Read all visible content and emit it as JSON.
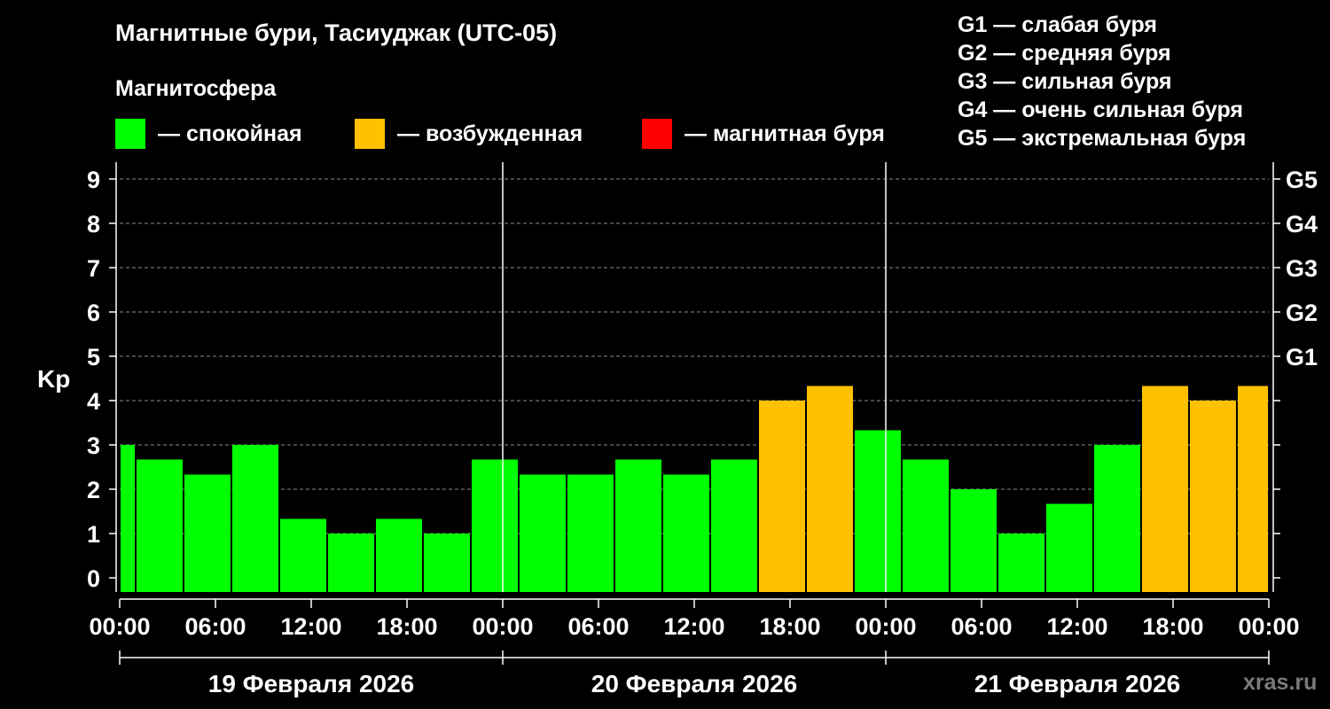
{
  "title": "Магнитные бури, Тасиуджак (UTC-05)",
  "magnetosphere_label": "Магнитосфера",
  "legend": [
    {
      "color": "#00FF00",
      "label": "— спокойная"
    },
    {
      "color": "#FFC000",
      "label": "— возбужденная"
    },
    {
      "color": "#FF0000",
      "label": "— магнитная буря"
    }
  ],
  "storm_levels": [
    "G1 — слабая буря",
    "G2 — средняя буря",
    "G3 — сильная буря",
    "G4 — очень сильная буря",
    "G5 — экстремальная буря"
  ],
  "watermark": "xras.ru",
  "chart_data": {
    "type": "bar",
    "ylabel": "Kp",
    "ylim": [
      0,
      9
    ],
    "yticks": [
      0,
      1,
      2,
      3,
      4,
      5,
      6,
      7,
      8,
      9
    ],
    "right_ticks": [
      {
        "value": 5,
        "label": "G1"
      },
      {
        "value": 6,
        "label": "G2"
      },
      {
        "value": 7,
        "label": "G3"
      },
      {
        "value": 8,
        "label": "G4"
      },
      {
        "value": 9,
        "label": "G5"
      }
    ],
    "xtick_labels": [
      "00:00",
      "06:00",
      "12:00",
      "18:00",
      "00:00",
      "06:00",
      "12:00",
      "18:00",
      "00:00",
      "06:00",
      "12:00",
      "18:00",
      "00:00"
    ],
    "days": [
      "19 Февраля 2026",
      "20 Февраля 2026",
      "21 Февраля 2026"
    ],
    "grid": "dashed horizontal at integer Kp, solid vertical at day boundaries",
    "bars": [
      {
        "start_hour": 0,
        "end_hour": 1,
        "kp": 3.0,
        "state": "quiet"
      },
      {
        "start_hour": 1,
        "end_hour": 4,
        "kp": 2.67,
        "state": "quiet"
      },
      {
        "start_hour": 4,
        "end_hour": 7,
        "kp": 2.33,
        "state": "quiet"
      },
      {
        "start_hour": 7,
        "end_hour": 10,
        "kp": 3.0,
        "state": "quiet"
      },
      {
        "start_hour": 10,
        "end_hour": 13,
        "kp": 1.33,
        "state": "quiet"
      },
      {
        "start_hour": 13,
        "end_hour": 16,
        "kp": 1.0,
        "state": "quiet"
      },
      {
        "start_hour": 16,
        "end_hour": 19,
        "kp": 1.33,
        "state": "quiet"
      },
      {
        "start_hour": 19,
        "end_hour": 22,
        "kp": 1.0,
        "state": "quiet"
      },
      {
        "start_hour": 22,
        "end_hour": 25,
        "kp": 2.67,
        "state": "quiet"
      },
      {
        "start_hour": 25,
        "end_hour": 28,
        "kp": 2.33,
        "state": "quiet"
      },
      {
        "start_hour": 28,
        "end_hour": 31,
        "kp": 2.33,
        "state": "quiet"
      },
      {
        "start_hour": 31,
        "end_hour": 34,
        "kp": 2.67,
        "state": "quiet"
      },
      {
        "start_hour": 34,
        "end_hour": 37,
        "kp": 2.33,
        "state": "quiet"
      },
      {
        "start_hour": 37,
        "end_hour": 40,
        "kp": 2.67,
        "state": "quiet"
      },
      {
        "start_hour": 40,
        "end_hour": 43,
        "kp": 4.0,
        "state": "unsettled"
      },
      {
        "start_hour": 43,
        "end_hour": 46,
        "kp": 4.33,
        "state": "unsettled"
      },
      {
        "start_hour": 46,
        "end_hour": 49,
        "kp": 3.33,
        "state": "quiet"
      },
      {
        "start_hour": 49,
        "end_hour": 52,
        "kp": 2.67,
        "state": "quiet"
      },
      {
        "start_hour": 52,
        "end_hour": 55,
        "kp": 2.0,
        "state": "quiet"
      },
      {
        "start_hour": 55,
        "end_hour": 58,
        "kp": 1.0,
        "state": "quiet"
      },
      {
        "start_hour": 58,
        "end_hour": 61,
        "kp": 1.67,
        "state": "quiet"
      },
      {
        "start_hour": 61,
        "end_hour": 64,
        "kp": 3.0,
        "state": "quiet"
      },
      {
        "start_hour": 64,
        "end_hour": 67,
        "kp": 4.33,
        "state": "unsettled"
      },
      {
        "start_hour": 67,
        "end_hour": 70,
        "kp": 4.0,
        "state": "unsettled"
      },
      {
        "start_hour": 70,
        "end_hour": 72,
        "kp": 4.33,
        "state": "unsettled"
      }
    ],
    "state_colors": {
      "quiet": "#00FF00",
      "unsettled": "#FFC000",
      "storm": "#FF0000"
    }
  }
}
